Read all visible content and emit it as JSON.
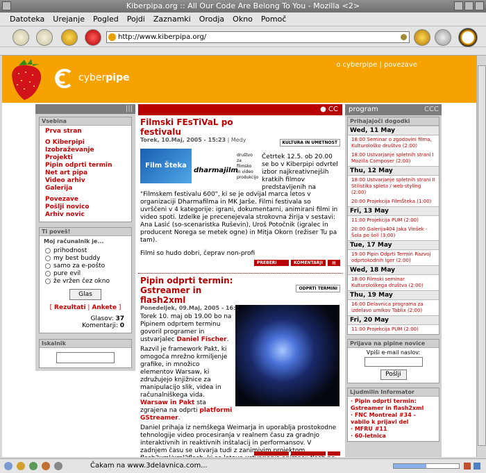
{
  "window": {
    "title": "Kiberpipa.org :: All Our Code Are Belong To You - Mozilla <2>"
  },
  "menu": [
    "Datoteka",
    "Urejanje",
    "Pogled",
    "Pojdi",
    "Zaznamki",
    "Orodja",
    "Okno",
    "Pomoč"
  ],
  "url": "http://www.kiberpipa.org/",
  "status": "Čakam na www.3delavnica.com...",
  "site": {
    "logo_pre": "cyber",
    "logo_bold": "pipe",
    "toplinks": "o cyberpipe | povezave"
  },
  "left": {
    "vsebina_label": "Vsebina",
    "menu1": [
      "Prva stran"
    ],
    "menu2": [
      "O Kiberpipi",
      "Izobraževanje",
      "Projekti",
      "Pipin odprti termin",
      "Net art pipa",
      "Video arhiv",
      "Galerija"
    ],
    "menu3": [
      "Povezave",
      "Pošlji novico",
      "Arhiv novic"
    ],
    "poll_label": "Ti poveš!",
    "poll_question": "Moj računalnik je...",
    "poll_options": [
      "prihodnost",
      "my best buddy",
      "samo za e-pošto",
      "pure evil",
      "že vržen čez okno"
    ],
    "vote_button": "Glas",
    "results": "Rezultati",
    "polls": "Ankete",
    "votes_label": "Glasov:",
    "votes": "37",
    "comments_label": "Komentarji:",
    "comments": "0",
    "search_label": "Iskalnik"
  },
  "center": {
    "cc": "CC",
    "article1": {
      "title": "Filmski FEsTiVaL po festivalu",
      "date": "Torek, 10.Maj, 2005 - 15:23",
      "author": "Medy",
      "category": "KULTURA IN UMETNOST",
      "img_caption": "Film Šteka",
      "brand": "dharmajilm",
      "brand_sub": "društvo za filmsko in video produkcijo",
      "lead": "Četrtek 12.5. ob 20.00 se bo v Kiberpipi odvrtel izbor najkreativnejših kratkih filmov predstavljenih na",
      "body": "\"Filmskem festivalu 600\", ki se je odvijal marca letos v organizaciji Dharmafilma in MK Jarše. Filmi festivala so uvrščeni v 4 kategorije: igrani, dokumentarni, animirani filmi in video spoti. Izdelke je precenejevala strokovna žirija v sestavi: Ana Lasić (so-scenaristka Ruševin), Uroš Potočnik (igralec in producent Norega se metek ogne) in Mitja Okorn (režiser Tu pa tam).",
      "end": "Filmi so hudo dobri, čeprav non-profi",
      "btn_read": "PREBERI VEČ",
      "btn_comment": "KOMENTARJI"
    },
    "article2": {
      "title": "Pipin odprti termin: Gstreamer in flash2xml",
      "date": "Ponedeljek, 09.Maj, 2005 - 16:51",
      "author": "minmax",
      "category": "ODPRTI TERMINI",
      "p1_pre": "Torek 10. maj ob 19.00 bo na Pipinem odprtem terminu govoril programer in ustvarjalec",
      "p1_name": "Daniel Fischer",
      "p2_pre": "Razvil je framework Pakt, ki omogoča mrežno krmiljenje grafike, in množico elementov Warsaw, ki združujejo knjižnice za manipulacijo slik, videa in računalniškega vida.",
      "p2_hl1": "Warsaw in Pakt",
      "p2_mid": "sta zgrajena na odprti",
      "p2_hl2": "platformi GStreamer",
      "p3": "Daniel prihaja iz nemškega Weimarja in uporablja prostokodne tehnologije video procesiranja v realnem času za gradnjo interaktivnih in reaktivnih inštalacij in performansov. V zadnjem času se ukvarja tudi z zanimivim projektom flash2xml/xml2flash, ki se loteva ustvarjanja animacij flash na drugačen način od ustaljenih."
    }
  },
  "right": {
    "program_label": "program",
    "upcoming_label": "Prihajajoči dogodki",
    "days": [
      {
        "day": "Wed, 11 May",
        "events": [
          "18:00 Seminar o zgodovini filma, Kulturološko društvo (2:00)",
          "18:00 Ustvarjanje spletnih strani I Mozilla Composer (2:00)"
        ]
      },
      {
        "day": "Thu, 12 May",
        "events": [
          "18:00 Ustvarjanje spletnih strani II Stilistika spleta / web-styling (2:00)",
          "20:00 Projekcija FilmŠteka (1:00)"
        ]
      },
      {
        "day": "Fri, 13 May",
        "events": [
          "11:00 Projekcija PUM (2:00)",
          "20:00 Galerija404 Jaka Vinšek - Šola po šoli (3:00)"
        ]
      },
      {
        "day": "Tue, 17 May",
        "events": [
          "19:00 Pipin Odprti Termin Razvoj odprtokodnih iger (2:00)"
        ]
      },
      {
        "day": "Wed, 18 May",
        "events": [
          "18:00 Filmski seminar Kulturološkega društva (2:00)"
        ]
      },
      {
        "day": "Thu, 19 May",
        "events": [
          "16:00 Delavnica programa za izdelavo umikov Tablix (2:00)"
        ]
      },
      {
        "day": "Fri, 20 May",
        "events": [
          "11:00 Projekcija PUM (2:00)"
        ]
      }
    ],
    "newsletter_label": "Prijava na pipine novice",
    "email_prompt": "Vpiši e-mail naslov:",
    "send_button": "Pošlji",
    "ljud_label": "Ljudmilin Informator",
    "ljud_items": [
      "Pipin odprti termin: Gstreamer in flash2xml",
      "FNC Montreal #34 - vabilo k prijavi del",
      "MFRU #11",
      "60-letnica"
    ]
  }
}
